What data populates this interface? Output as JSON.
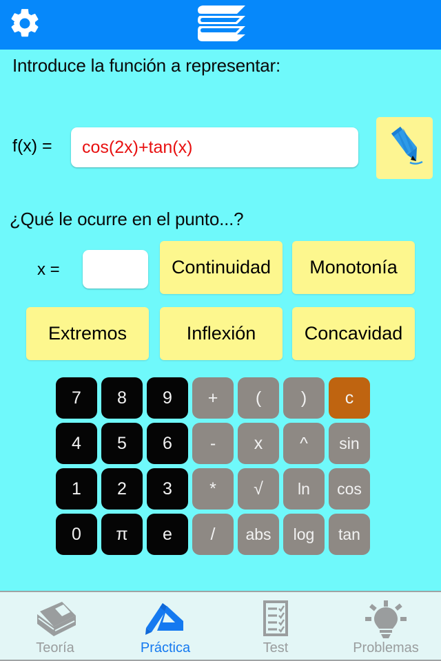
{
  "header": {
    "settings_icon": "gear-icon",
    "logo_icon": "book-stack-logo-icon",
    "background_color": "#0688FA"
  },
  "content": {
    "prompt_function": "Introduce la función a representar:",
    "prompt_point": "¿Qué le ocurre en el punto...?",
    "function_label": "f(x) =",
    "function_value": "cos(2x)+tan(x)",
    "function_value_color": "#E81010",
    "function_placeholder": "",
    "draw_button_icon": "pencil-icon",
    "x_label": "x =",
    "x_value": "",
    "x_placeholder": ""
  },
  "analysis_buttons": [
    {
      "label": "Continuidad"
    },
    {
      "label": "Monotonía"
    },
    {
      "label": "Extremos"
    },
    {
      "label": "Inflexión"
    },
    {
      "label": "Concavidad"
    }
  ],
  "keypad": {
    "accent_clear_color": "#BF6410",
    "digit_color": "#050505",
    "operator_color": "#8E8984",
    "keys": [
      {
        "label": "7",
        "kind": "digit"
      },
      {
        "label": "8",
        "kind": "digit"
      },
      {
        "label": "9",
        "kind": "digit"
      },
      {
        "label": "+",
        "kind": "op"
      },
      {
        "label": "(",
        "kind": "op"
      },
      {
        "label": ")",
        "kind": "op"
      },
      {
        "label": "c",
        "kind": "clear"
      },
      {
        "label": "4",
        "kind": "digit"
      },
      {
        "label": "5",
        "kind": "digit"
      },
      {
        "label": "6",
        "kind": "digit"
      },
      {
        "label": "-",
        "kind": "op"
      },
      {
        "label": "x",
        "kind": "op"
      },
      {
        "label": "^",
        "kind": "op"
      },
      {
        "label": "sin",
        "kind": "op"
      },
      {
        "label": "1",
        "kind": "digit"
      },
      {
        "label": "2",
        "kind": "digit"
      },
      {
        "label": "3",
        "kind": "digit"
      },
      {
        "label": "*",
        "kind": "op"
      },
      {
        "label": "√",
        "kind": "op"
      },
      {
        "label": "ln",
        "kind": "op"
      },
      {
        "label": "cos",
        "kind": "op"
      },
      {
        "label": "0",
        "kind": "digit"
      },
      {
        "label": "π",
        "kind": "digit"
      },
      {
        "label": "e",
        "kind": "digit"
      },
      {
        "label": "/",
        "kind": "op"
      },
      {
        "label": "abs",
        "kind": "op"
      },
      {
        "label": "log",
        "kind": "op"
      },
      {
        "label": "tan",
        "kind": "op"
      }
    ]
  },
  "tabbar": {
    "active_color": "#1479F0",
    "inactive_color": "#9A9D9E",
    "tabs": [
      {
        "label": "Teoría",
        "icon": "book-icon",
        "active": false
      },
      {
        "label": "Práctica",
        "icon": "ruler-pencil-icon",
        "active": true
      },
      {
        "label": "Test",
        "icon": "checklist-icon",
        "active": false
      },
      {
        "label": "Problemas",
        "icon": "lightbulb-icon",
        "active": false
      }
    ]
  }
}
